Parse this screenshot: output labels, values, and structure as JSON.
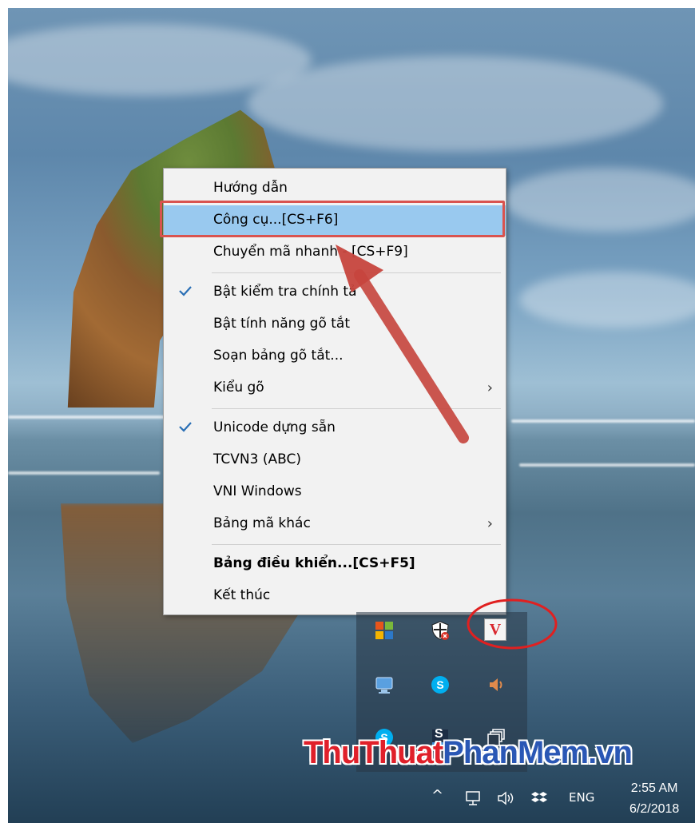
{
  "menu": {
    "items": [
      {
        "label": "Hướng dẫn"
      },
      {
        "label": "Công cụ...[CS+F6]"
      },
      {
        "label": "Chuyển mã nhanh - [CS+F9]"
      },
      {
        "label": "Bật kiểm tra chính tả"
      },
      {
        "label": "Bật tính năng gõ tắt"
      },
      {
        "label": "Soạn bảng gõ tắt..."
      },
      {
        "label": "Kiểu gõ"
      },
      {
        "label": "Unicode dựng sẵn"
      },
      {
        "label": "TCVN3 (ABC)"
      },
      {
        "label": "VNI Windows"
      },
      {
        "label": "Bảng mã khác"
      },
      {
        "label": "Bảng điều khiển...[CS+F5]"
      },
      {
        "label": "Kết thúc"
      }
    ],
    "checked": [
      "Bật kiểm tra chính tả",
      "Unicode dựng sẵn"
    ],
    "highlighted": "Công cụ...[CS+F6]",
    "submenu_arrow": "›"
  },
  "tray": {
    "icons": [
      "windows-tiles-icon",
      "shield-x-icon",
      "vietkey-v-icon",
      "network-monitor-icon",
      "skype-icon",
      "speaker-icon",
      "skype-icon",
      "s-app-icon",
      "window-stack-icon"
    ],
    "v_letter": "V",
    "s_letter": "S"
  },
  "watermark": {
    "part1": "ThuThuat",
    "part2": "PhanMem",
    "part3": ".vn"
  },
  "taskbar": {
    "chevron": "^",
    "language": "ENG",
    "time": "2:55 AM",
    "date": "6/2/2018"
  },
  "colors": {
    "highlight": "#99c9ef",
    "annotation_red": "#d9534f",
    "menu_bg": "#f2f2f2"
  }
}
